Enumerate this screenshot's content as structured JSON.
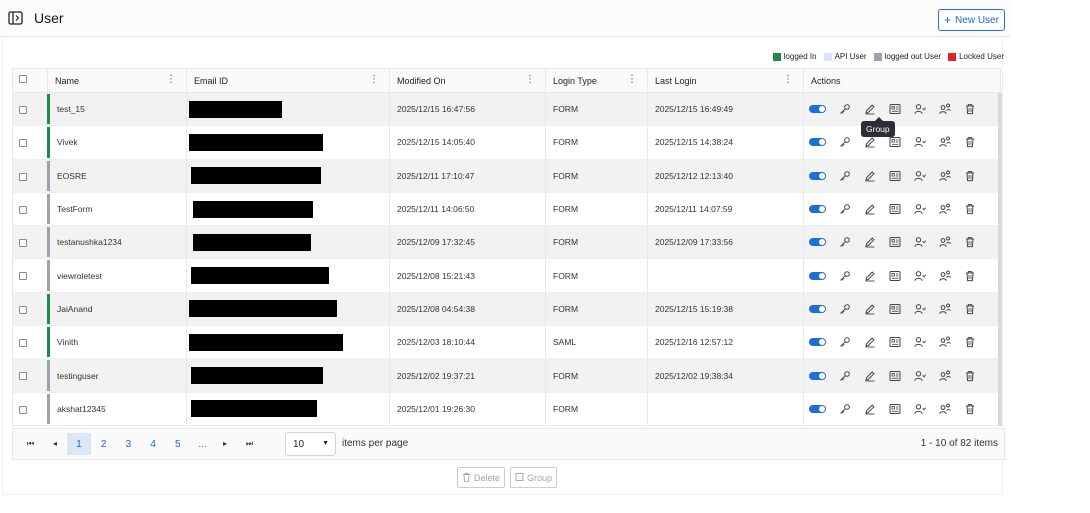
{
  "header": {
    "title": "User",
    "new_user_label": "New User"
  },
  "legend": [
    {
      "label": "logged In",
      "color": "#1b8a4a"
    },
    {
      "label": "API User",
      "color": "#dbe5f5"
    },
    {
      "label": "logged out User",
      "color": "#9aa3ad"
    },
    {
      "label": "Locked User",
      "color": "#e5202a"
    }
  ],
  "columns": [
    "Name",
    "Email ID",
    "Modified On",
    "Login Type",
    "Last Login",
    "Actions"
  ],
  "rows": [
    {
      "name": "test_15",
      "modified": "2025/12/15 16:47:56",
      "login_type": "FORM",
      "last_login": "2025/12/15 16:49:49",
      "status": "logged-in",
      "status_color": "#1b8a4a",
      "email_redaction_pct": 0.46,
      "email_redaction_offset_pct": 0.0
    },
    {
      "name": "Vivek",
      "modified": "2025/12/15 14:05:40",
      "login_type": "FORM",
      "last_login": "2025/12/15 14:38:24",
      "status": "logged-in",
      "status_color": "#1b8a4a",
      "email_redaction_pct": 0.66,
      "email_redaction_offset_pct": 0.0
    },
    {
      "name": "EOSRE",
      "modified": "2025/12/11 17:10:47",
      "login_type": "FORM",
      "last_login": "2025/12/12 12:13:40",
      "status": "logged-out",
      "status_color": "#9aa3ad",
      "email_redaction_pct": 0.64,
      "email_redaction_offset_pct": 0.01
    },
    {
      "name": "TestForm",
      "modified": "2025/12/11 14:06:50",
      "login_type": "FORM",
      "last_login": "2025/12/11 14:07:59",
      "status": "logged-out",
      "status_color": "#9aa3ad",
      "email_redaction_pct": 0.59,
      "email_redaction_offset_pct": 0.02
    },
    {
      "name": "testanushka1234",
      "modified": "2025/12/09 17:32:45",
      "login_type": "FORM",
      "last_login": "2025/12/09 17:33:56",
      "status": "logged-out",
      "status_color": "#9aa3ad",
      "email_redaction_pct": 0.58,
      "email_redaction_offset_pct": 0.02
    },
    {
      "name": "viewroletest",
      "modified": "2025/12/08 15:21:43",
      "login_type": "FORM",
      "last_login": "",
      "status": "logged-out",
      "status_color": "#9aa3ad",
      "email_redaction_pct": 0.68,
      "email_redaction_offset_pct": 0.01
    },
    {
      "name": "JaiAnand",
      "modified": "2025/12/08 04:54:38",
      "login_type": "FORM",
      "last_login": "2025/12/15 15:19:38",
      "status": "logged-in",
      "status_color": "#1b8a4a",
      "email_redaction_pct": 0.73,
      "email_redaction_offset_pct": 0.0
    },
    {
      "name": "Vinith",
      "modified": "2025/12/03 18:10:44",
      "login_type": "SAML",
      "last_login": "2025/12/16 12:57:12",
      "status": "logged-in",
      "status_color": "#1b8a4a",
      "email_redaction_pct": 0.76,
      "email_redaction_offset_pct": 0.0
    },
    {
      "name": "testinguser",
      "modified": "2025/12/02 19:37:21",
      "login_type": "FORM",
      "last_login": "2025/12/02 19:38:34",
      "status": "logged-out",
      "status_color": "#9aa3ad",
      "email_redaction_pct": 0.65,
      "email_redaction_offset_pct": 0.01
    },
    {
      "name": "akshat12345",
      "modified": "2025/12/01 19:26:30",
      "login_type": "FORM",
      "last_login": "",
      "status": "logged-out",
      "status_color": "#9aa3ad",
      "email_redaction_pct": 0.62,
      "email_redaction_offset_pct": 0.01
    }
  ],
  "actions": [
    "toggle-active",
    "key-icon",
    "edit-icon",
    "group-icon",
    "user-check-icon",
    "users-role-icon",
    "delete-icon"
  ],
  "tooltip": "Group",
  "pagination": {
    "pages": [
      "1",
      "2",
      "3",
      "4",
      "5",
      "..."
    ],
    "current": "1",
    "page_size": "10",
    "per_page_label": "items per page",
    "info": "1 - 10 of 82 items"
  },
  "bottom": {
    "delete_label": "Delete",
    "group_label": "Group"
  },
  "accent_color": "#1e66d0"
}
